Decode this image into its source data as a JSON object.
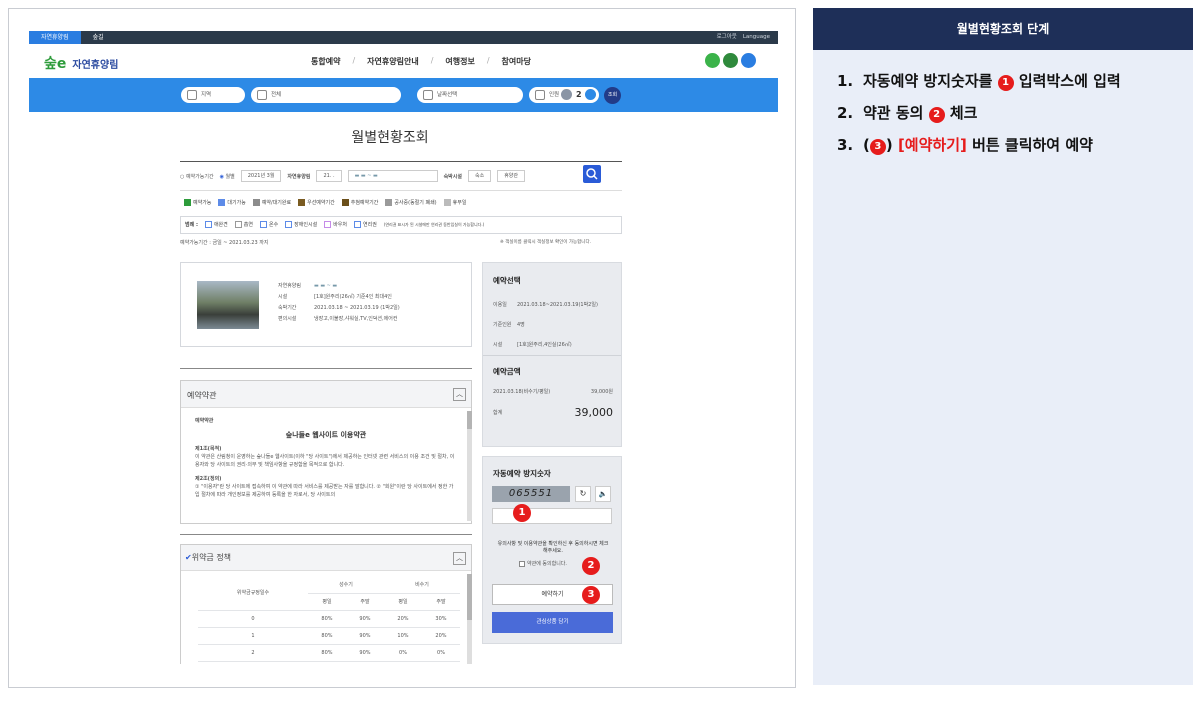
{
  "window": {
    "top_tabs": [
      "자연휴양림",
      "숲길"
    ],
    "utilities": [
      "로그아웃",
      "Language"
    ]
  },
  "nav": {
    "logo_text": "자연휴양림",
    "menu": [
      "통합예약",
      "자연휴양림안내",
      "여행정보",
      "참여마당"
    ]
  },
  "search": {
    "region": "지역",
    "facility": "전체",
    "date": "날짜선택",
    "guests_label": "인원",
    "guests_value": "2",
    "search_button": "조회"
  },
  "page": {
    "title": "월별현황조회"
  },
  "filters": {
    "radio_available": "예약가능기간",
    "radio_monthly": "월별",
    "month": "2021년 3월",
    "forest_label": "자연휴양림",
    "forest_value": "21. .",
    "lodging_label": "숙박시설",
    "lodging_value": "숙소",
    "period_value": "휴양관"
  },
  "legend": {
    "status": [
      "예약가능",
      "대기가능",
      "예약/대기완료",
      "우선예약기간",
      "추첨예약기간",
      "공사중(동절기 폐쇄)",
      "휴무일"
    ],
    "icons_label": "범례 :",
    "icons": [
      "애완견",
      "흡연",
      "온수",
      "장애인시설",
      "바우처",
      "연리권"
    ],
    "icons_note": "(연리권 표시가 된 시설에만 연리권 동반입실이 가능합니다.)",
    "period_text": "예약가능기간 : 금일 ~ 2021.03.23 까지",
    "tip": "※ 객실이름 클릭시 객실정보 확인이 가능합니다."
  },
  "room_info": {
    "forest_label": "자연휴양림",
    "facility_label": "시설",
    "facility_value": "[1호]원주리(26㎡) 기준4인 최대4인",
    "stay_label": "숙박기간",
    "stay_value": "2021.03.18 ~ 2021.03.19 (1박2일)",
    "amenity_label": "편의시설",
    "amenity_value": "냉장고,이불장,샤워실,TV,인덕션,에어컨"
  },
  "terms": {
    "section_title": "예약약관",
    "inner_label": "예약약관",
    "doc_title": "숲나들e 웹사이트 이용약관",
    "art1_title": "제1조(목적)",
    "art1_body": "이 약관은 산림청이 운영하는 숲나들e 웹사이트(이하 \"당 사이트\")에서 제공하는 인터넷 관련 서비스의 이용 조건 및 절차, 이용자와 당 사이트의 권리·의무 및 책임사항을 규정함을 목적으로 합니다.",
    "art2_title": "제2조(정의)",
    "art2_body": "① \"이용자\"란 당 사이트에 접속하여 이 약관에 따라 서비스를 제공받는 자를 말합니다. ② \"회원\"이란 당 사이트에서 정한 가입 절차에 따라 개인정보를 제공하여 등록을 한 자로서, 당 사이트의"
  },
  "penalty": {
    "title": "위약금 정책",
    "col_group1": "성수기",
    "col_group2": "비수기",
    "head_row": "위약금규정일수",
    "sub": [
      "평일",
      "주말",
      "평일",
      "주말"
    ],
    "rows": [
      [
        "0",
        "80%",
        "90%",
        "20%",
        "30%"
      ],
      [
        "1",
        "80%",
        "90%",
        "10%",
        "20%"
      ],
      [
        "2",
        "80%",
        "90%",
        "0%",
        "0%"
      ]
    ]
  },
  "reservation": {
    "select_title": "예약선택",
    "use_date_label": "이용일",
    "use_date_value": "2021.03.18~2021.03.19(1박2일)",
    "base_label": "기준인원",
    "base_value": "4명",
    "facility_label": "시설",
    "facility_value": "[1호]원주리,4인실(26㎡)",
    "amount_title": "예약금액",
    "amount_line_label": "2021.03.18(비수기/평일)",
    "amount_line_value": "39,000원",
    "total_label": "합계",
    "total_value": "39,000"
  },
  "antibot": {
    "title": "자동예약 방지숫자",
    "captcha": "065551",
    "input_placeholder": "",
    "agree_notice": "유의사항 및 이용약관을 확인하신 후 동의하시면 체크해주세요.",
    "agree_checkbox": "약관에 동의합니다.",
    "reserve_button": "예약하기",
    "wish_button": "관심상품 담기"
  },
  "markers": [
    "1",
    "2",
    "3"
  ],
  "side": {
    "header": "월별현황조회 단계",
    "steps": [
      {
        "num": "1.",
        "before": "자동예약 방지숫자를 ",
        "badge": "1",
        "after": " 입력박스에 입력"
      },
      {
        "num": "2.",
        "before": "약관 동의 ",
        "badge": "2",
        "after": " 체크"
      },
      {
        "num": "3.",
        "before": "(",
        "badge": "3",
        "after": ") ",
        "red": "[예약하기]",
        "tail": " 버튼 클릭하여 예약"
      }
    ]
  },
  "colors": {
    "nav_bar": "#2d8ae6",
    "dark_bar": "#2b3a4a",
    "side_header": "#1e2f58",
    "side_bg": "#e9eef8",
    "marker_red": "#e61c1c",
    "button_blue": "#4a6bd8"
  }
}
